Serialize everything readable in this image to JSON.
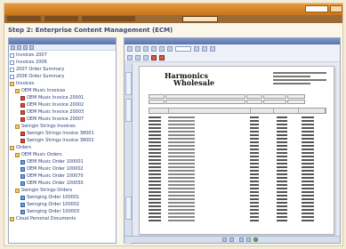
{
  "heading": "Step 2: Enterprise Content Management (ECM)",
  "icons": [
    "document-icon",
    "folder-icon",
    "pdf-icon",
    "group-icon"
  ],
  "colors": {
    "accent": "#c8741a",
    "nav": "#9c6a34",
    "heading": "#3c4b7c",
    "panel": "#5a74a8"
  },
  "tree": [
    {
      "label": "Invoices 2007",
      "icon": "doc",
      "indent": 0
    },
    {
      "label": "Invoices 2006",
      "icon": "doc",
      "indent": 0
    },
    {
      "label": "2007 Order Summary",
      "icon": "doc",
      "indent": 0
    },
    {
      "label": "2006 Order Summary",
      "icon": "doc",
      "indent": 0
    },
    {
      "label": "Invoices",
      "icon": "folder",
      "indent": 0
    },
    {
      "label": "OEM Music Invoices",
      "icon": "folder",
      "indent": 1
    },
    {
      "label": "OEM Music Invoice 20001",
      "icon": "pdf",
      "indent": 2
    },
    {
      "label": "OEM Music Invoice 20002",
      "icon": "pdf",
      "indent": 2
    },
    {
      "label": "OEM Music Invoice 20003",
      "icon": "pdf",
      "indent": 2
    },
    {
      "label": "OEM Music Invoice 20007",
      "icon": "pdf",
      "indent": 2
    },
    {
      "label": "Swingin Strings Invoices",
      "icon": "folder",
      "indent": 1
    },
    {
      "label": "Swingin Strings Invoice 38001",
      "icon": "pdf",
      "indent": 2
    },
    {
      "label": "Swingin Strings Invoice 38002",
      "icon": "pdf",
      "indent": 2
    },
    {
      "label": "Orders",
      "icon": "folder",
      "indent": 0
    },
    {
      "label": "OEM Music Orders",
      "icon": "folder",
      "indent": 1
    },
    {
      "label": "OEM Music Order 100001",
      "icon": "grp",
      "indent": 2
    },
    {
      "label": "OEM Music Order 100002",
      "icon": "grp",
      "indent": 2
    },
    {
      "label": "OEM Music Order 100070",
      "icon": "grp",
      "indent": 2
    },
    {
      "label": "OEM Music Order 100050",
      "icon": "grp",
      "indent": 2
    },
    {
      "label": "Swingin Strings Orders",
      "icon": "folder",
      "indent": 1
    },
    {
      "label": "Swinging Order 100001",
      "icon": "grp",
      "indent": 2
    },
    {
      "label": "Swinging Order 100002",
      "icon": "grp",
      "indent": 2
    },
    {
      "label": "Swinging Order 100003",
      "icon": "grp",
      "indent": 2
    },
    {
      "label": "Cloud Personal Documents",
      "icon": "folder",
      "indent": 0
    }
  ],
  "viewer": {
    "logo_line1": "Harmonics",
    "logo_line2": "Wholesale"
  }
}
